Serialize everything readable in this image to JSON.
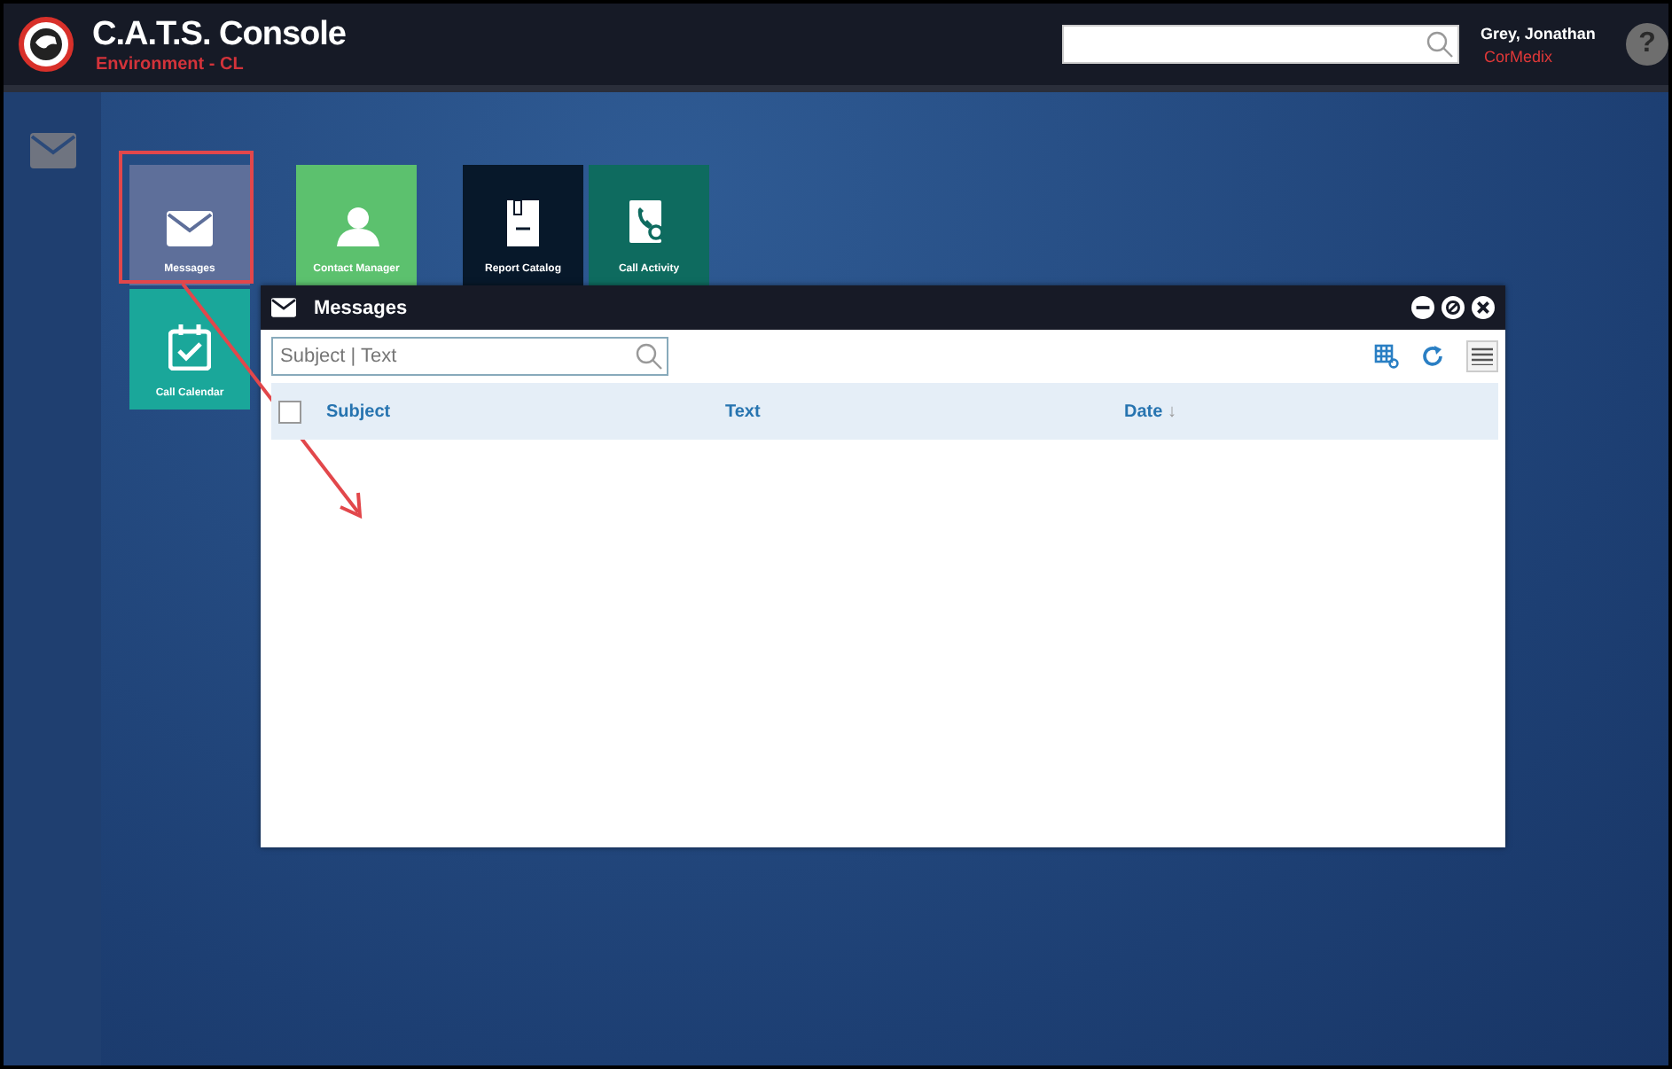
{
  "header": {
    "title": "C.A.T.S. Console",
    "environment": "Environment - CL",
    "user_name": "Grey, Jonathan",
    "company": "CorMedix",
    "help": "?"
  },
  "tiles": [
    {
      "label": "Messages",
      "kind": "mail",
      "color": "#5e6f9a"
    },
    {
      "label": "Contact Manager",
      "kind": "contact",
      "color": "#5cc16e"
    },
    {
      "label": "Report Catalog",
      "kind": "report",
      "color": "#07182a"
    },
    {
      "label": "Call Activity",
      "kind": "call",
      "color": "#0e6b5f"
    },
    {
      "label": "Call Calendar",
      "kind": "calendar",
      "color": "#1aa79a"
    }
  ],
  "window": {
    "title": "Messages",
    "search": {
      "placeholder": "Subject | Text"
    },
    "table": {
      "select_all": {
        "checked": false
      },
      "columns": [
        {
          "label": "Subject"
        },
        {
          "label": "Text"
        },
        {
          "label": "Date",
          "sort": "↓"
        }
      ]
    }
  }
}
